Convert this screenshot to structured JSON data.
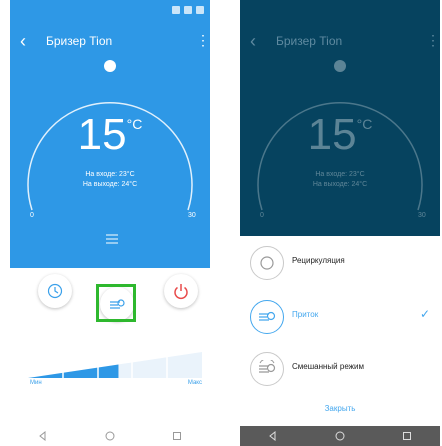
{
  "app": {
    "title": "Бризер Tion"
  },
  "main": {
    "temperature": "15",
    "unit": "°C",
    "inlet": "На входе: 23°C",
    "outlet": "На выходе: 24°C",
    "scale_min": "0",
    "scale_max": "30"
  },
  "speed": {
    "min_label": "Мин",
    "max_label": "Макс",
    "level_fraction": 0.52
  },
  "mode_sheet": {
    "options": [
      {
        "label": "Рециркуляция"
      },
      {
        "label": "Приток"
      },
      {
        "label": "Смешанный режим"
      }
    ],
    "close_label": "Закрыть"
  },
  "colors": {
    "brand_blue": "#2e98e6",
    "dark_overlay": "#06435f",
    "accent_blue": "#43a7ee",
    "power_red": "#e84a4a",
    "highlight_green": "#2eb82e"
  }
}
